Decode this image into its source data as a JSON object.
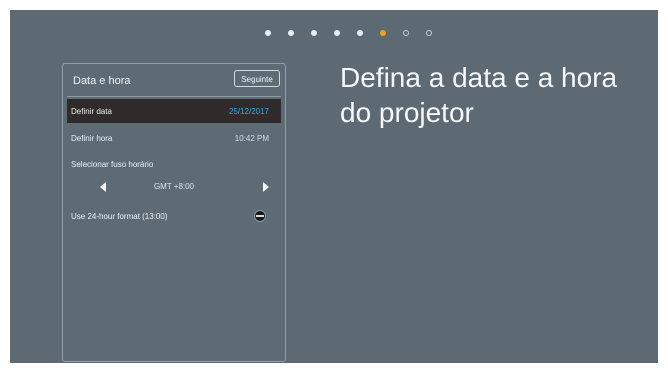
{
  "wizard": {
    "dots": [
      "filled",
      "filled",
      "filled",
      "filled",
      "filled",
      "active",
      "empty",
      "empty"
    ]
  },
  "panel": {
    "title": "Data e hora",
    "next_label": "Seguinte"
  },
  "settings": {
    "date_label": "Definir data",
    "date_value": "25/12/2017",
    "time_label": "Definir hora",
    "time_value": "10:42 PM",
    "timezone_label": "Selecionar fuso horário",
    "timezone_value": "GMT +8:00",
    "format_label": "Use 24-hour format (13:00)"
  },
  "main": {
    "heading": "Defina a data e a hora do projetor"
  },
  "colors": {
    "background": "#5d6a74",
    "selected_row": "#2f2b2a",
    "accent_blue": "#41a8e8",
    "active_dot": "#f0a21c"
  }
}
